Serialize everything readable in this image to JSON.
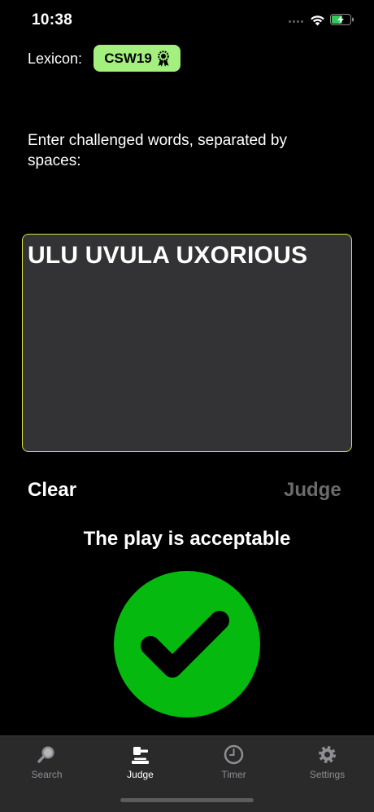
{
  "status": {
    "time": "10:38"
  },
  "lexicon": {
    "label": "Lexicon:",
    "value": "CSW19"
  },
  "instructions": "Enter challenged words, separated by spaces:",
  "words_input": {
    "value": "ULU UVULA UXORIOUS"
  },
  "buttons": {
    "clear": "Clear",
    "judge": "Judge"
  },
  "result": {
    "text": "The play is acceptable",
    "status": "acceptable",
    "color": "#06b90e"
  },
  "tabs": [
    {
      "label": "Search",
      "icon": "magnifier-icon",
      "active": false
    },
    {
      "label": "Judge",
      "icon": "gavel-icon",
      "active": true
    },
    {
      "label": "Timer",
      "icon": "clock-icon",
      "active": false
    },
    {
      "label": "Settings",
      "icon": "gear-icon",
      "active": false
    }
  ],
  "colors": {
    "accent_pill": "#a3f07f",
    "input_border": "#d7e14a",
    "background": "#000000"
  }
}
